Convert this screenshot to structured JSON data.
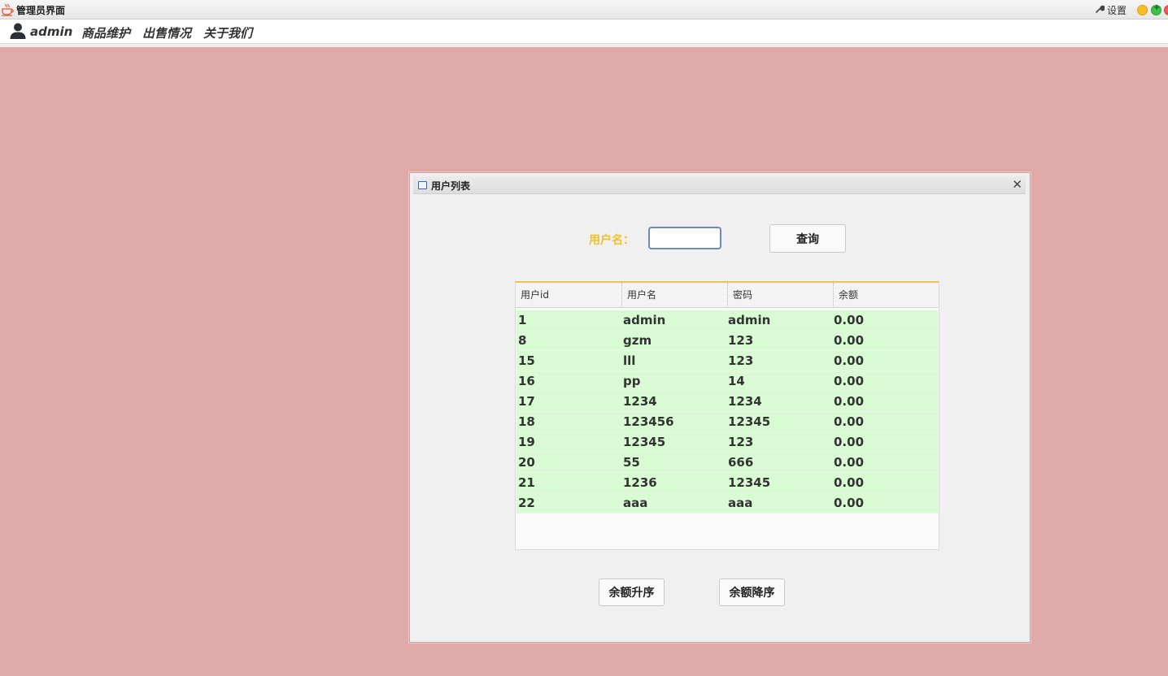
{
  "window": {
    "title": "管理员界面",
    "settings_label": "设置"
  },
  "menubar": {
    "user_label": "admin",
    "items": [
      "商品维护",
      "出售情况",
      "关于我们"
    ]
  },
  "frame": {
    "title": "用户列表",
    "search": {
      "label": "用户名：",
      "value": ""
    },
    "query_button": "查询",
    "table": {
      "columns": [
        "用户id",
        "用户名",
        "密码",
        "余额"
      ],
      "rows": [
        [
          "1",
          "admin",
          "admin",
          "0.00"
        ],
        [
          "8",
          "gzm",
          "123",
          "0.00"
        ],
        [
          "15",
          "lll",
          "123",
          "0.00"
        ],
        [
          "16",
          "pp",
          "14",
          "0.00"
        ],
        [
          "17",
          "1234",
          "1234",
          "0.00"
        ],
        [
          "18",
          "123456",
          "12345",
          "0.00"
        ],
        [
          "19",
          "12345",
          "123",
          "0.00"
        ],
        [
          "20",
          "55",
          "666",
          "0.00"
        ],
        [
          "21",
          "1236",
          "12345",
          "0.00"
        ],
        [
          "22",
          "aaa",
          "aaa",
          "0.00"
        ]
      ]
    },
    "sort_asc_button": "余额升序",
    "sort_desc_button": "余额降序"
  },
  "colors": {
    "desktop": "#dea9a7",
    "label_accent": "#f0c12a",
    "row_background": "#d9fbd3"
  }
}
